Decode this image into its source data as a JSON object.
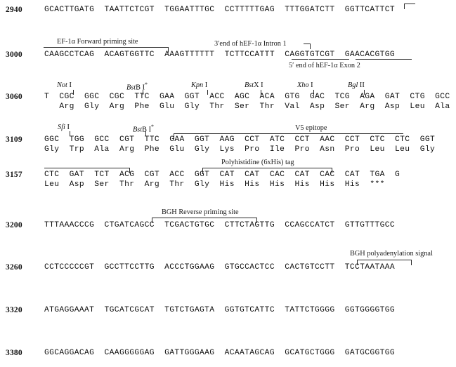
{
  "document": {
    "type": "plasmid-sequence-map",
    "description": "Multiple cloning site and flanking sequence of an expression vector"
  },
  "sequence_rows": [
    {
      "coord": "2940",
      "bases": "GCACTTGATG  TAATTCTCGT  TGGAATTTGC  CCTTTTTGAG  TTTGGATCTT  GGTTCATTCT"
    },
    {
      "coord": "3000",
      "bases": "CAAGCCTCAG  ACAGTGGTTC  AAAGTTTTTT  TCTTCCATTT  CAGGTGTCGT  GAACACGTGG"
    },
    {
      "coord": "3060",
      "bases": "T  CGC  GGC  CGC  TTC  GAA  GGT  ACC  AGC  ACA  GTG  GAC  TCG  AGA  GAT  CTG  GCC",
      "aa": "   Arg  Gly  Arg  Phe  Glu  Gly  Thr  Ser  Thr  Val  Asp  Ser  Arg  Asp  Leu  Ala"
    },
    {
      "coord": "3109",
      "bases": "GGC  TGG  GCC  CGT  TTC  GAA  GGT  AAG  CCT  ATC  CCT  AAC  CCT  CTC  CTC  GGT",
      "aa": "Gly  Trp  Ala  Arg  Phe  Glu  Gly  Lys  Pro  Ile  Pro  Asn  Pro  Leu  Leu  Gly"
    },
    {
      "coord": "3157",
      "bases": "CTC  GAT  TCT  ACG  CGT  ACC  GGT  CAT  CAT  CAC  CAT  CAC  CAT  TGA  G",
      "aa": "Leu  Asp  Ser  Thr  Arg  Thr  Gly  His  His  His  His  His  His  ***"
    },
    {
      "coord": "3200",
      "bases": "TTTAAACCCG  CTGATCAGCC  TCGACTGTGC  CTTCTAGTTG  CCAGCCATCT  GTTGTTTGCC"
    },
    {
      "coord": "3260",
      "bases": "CCTCCCCCGT  GCCTTCCTTG  ACCCTGGAAG  GTGCCACTCC  CACTGTCCTT  TCCTAATAAA"
    },
    {
      "coord": "3320",
      "bases": "ATGAGGAAAT  TGCATCGCAT  TGTCTGAGTA  GGTGTCATTC  TATTCTGGGG  GGTGGGGTGG"
    },
    {
      "coord": "3380",
      "bases": "GGCAGGACAG  CAAGGGGGAG  GATTGGGAAG  ACAATAGCAG  GCATGCTGGG  GATGCGGTGG"
    }
  ],
  "annotations": {
    "ef1a_forward_priming_site": "EF-1α Forward priming site",
    "hef1a_intron1_3end": "3′end of hEF-1α Intron 1",
    "hef1a_exon2_5end": "5′ end of hEF-1α Exon 2",
    "v5_epitope": "V5 epitope",
    "polyhistidine_tag": "Polyhistidine (6xHis) tag",
    "bgh_reverse_priming_site": "BGH Reverse priming site",
    "bgh_polyadenylation_signal": "BGH polyadenylation signal"
  },
  "restriction_sites": [
    {
      "italic": "Not",
      "roman": " I",
      "star": ""
    },
    {
      "italic": "Bst",
      "roman": "B I",
      "star": "*"
    },
    {
      "italic": "Kpn",
      "roman": " I",
      "star": ""
    },
    {
      "italic": "Bst",
      "roman": "X I",
      "star": ""
    },
    {
      "italic": "Xho",
      "roman": " I",
      "star": ""
    },
    {
      "italic": "Bgl",
      "roman": " II",
      "star": ""
    },
    {
      "italic": "Sfi",
      "roman": " I",
      "star": ""
    },
    {
      "italic": "Bst",
      "roman": "B I",
      "star": "*"
    }
  ],
  "colors": {
    "text": "#111111",
    "line": "#2b2b2b",
    "background": "#ffffff"
  }
}
